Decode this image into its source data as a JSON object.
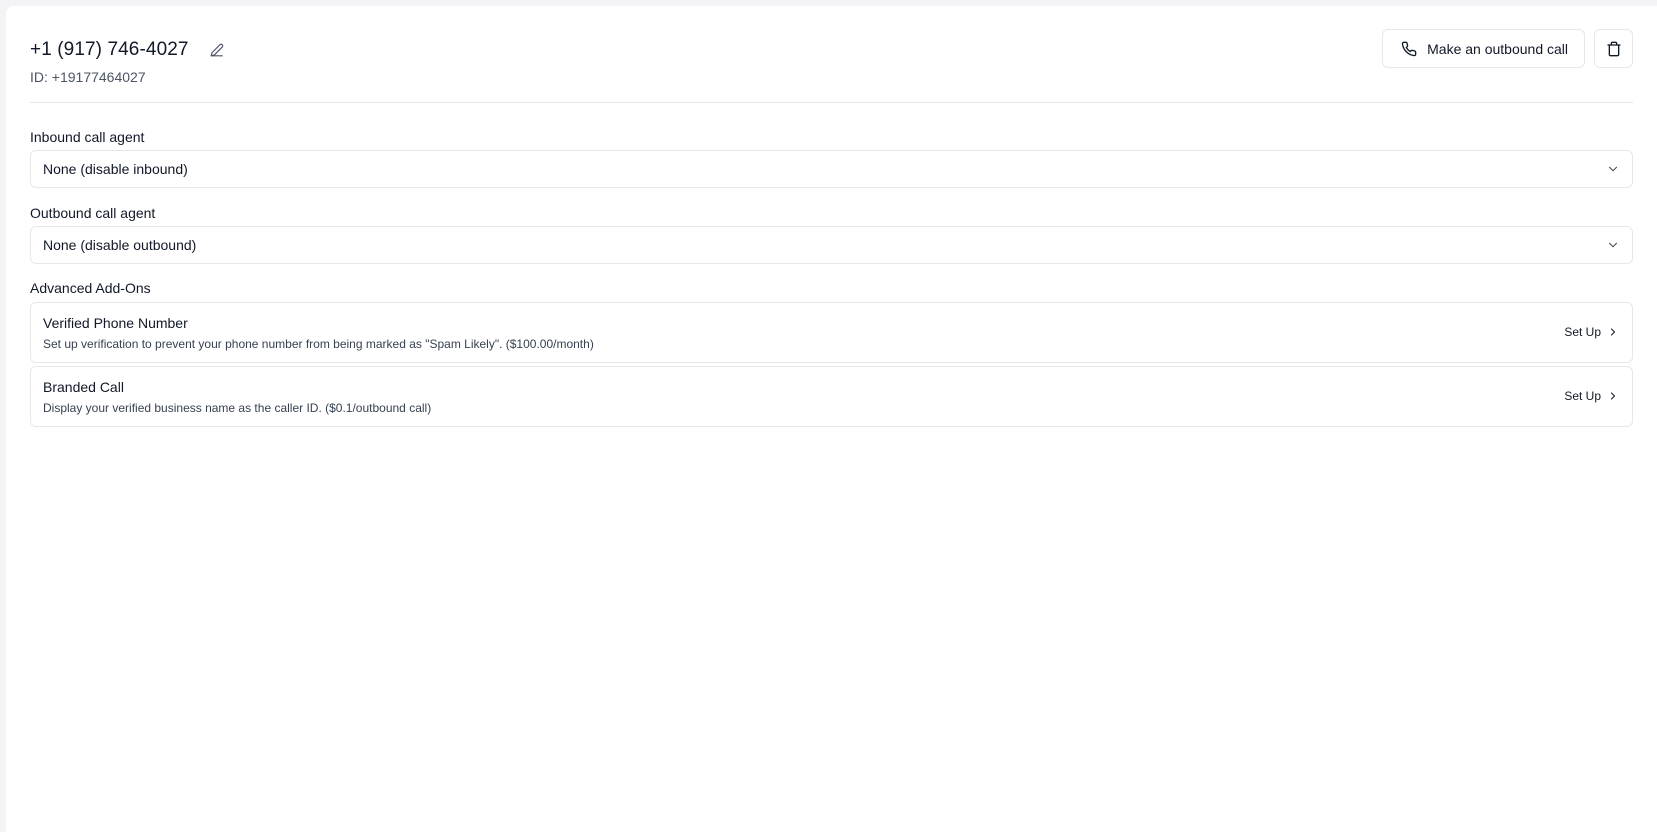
{
  "header": {
    "title": "+1 (917) 746-4027",
    "id_label": "ID: +19177464027",
    "call_button_label": "Make an outbound call"
  },
  "inbound": {
    "label": "Inbound call agent",
    "selected": "None (disable inbound)"
  },
  "outbound": {
    "label": "Outbound call agent",
    "selected": "None (disable outbound)"
  },
  "addons": {
    "label": "Advanced Add-Ons",
    "items": [
      {
        "title": "Verified Phone Number",
        "description": "Set up verification to prevent your phone number from being marked as \"Spam Likely\". ($100.00/month)",
        "action": "Set Up"
      },
      {
        "title": "Branded Call",
        "description": "Display your verified business name as the caller ID. ($0.1/outbound call)",
        "action": "Set Up"
      }
    ]
  },
  "icons": {
    "edit": "pencil-icon",
    "call": "phone-icon",
    "delete": "trash-icon",
    "dropdown": "chevron-down-icon",
    "setup": "chevron-right-icon"
  }
}
